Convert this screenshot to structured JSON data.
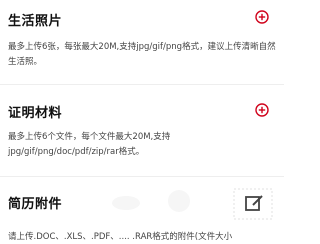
{
  "sections": [
    {
      "title": "生活照片",
      "desc": "最多上传6张，每张最大20M,支持jpg/gif/png格式，建议上传清晰自然生活照。",
      "action_icon": "plus-circle-icon"
    },
    {
      "title": "证明材料",
      "desc": "最多上传6个文件，每个文件最大20M,支持jpg/gif/png/doc/pdf/zip/rar格式。",
      "action_icon": "plus-circle-icon"
    },
    {
      "title": "简历附件",
      "desc": "请上传.DOC、.XLS、.PDF、.... .RAR格式的附件(文件大小",
      "action_icon": "edit-icon"
    }
  ],
  "colors": {
    "accent": "#d0021b",
    "edit_icon": "#444444",
    "edit_box": "#e0e0e0"
  }
}
